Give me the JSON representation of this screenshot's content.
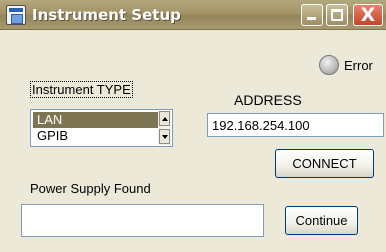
{
  "window": {
    "title": "Instrument Setup",
    "icon": "app-icon",
    "controls": [
      "minimize-icon",
      "maximize-icon",
      "close-icon"
    ],
    "close_glyph": "X"
  },
  "error_indicator": {
    "label": "Error",
    "state": "off",
    "color": "#BDBDBD"
  },
  "instrument_type": {
    "label": "Instrument TYPE",
    "options": [
      "LAN",
      "GPIB"
    ],
    "selected": "LAN",
    "selection_color": "#7D7451"
  },
  "address": {
    "label": "ADDRESS",
    "value": "192.168.254.100"
  },
  "connect_button": {
    "label": "CONNECT"
  },
  "power_supply": {
    "label": "Power Supply  Found",
    "value": ""
  },
  "continue_button": {
    "label": "Continue"
  }
}
